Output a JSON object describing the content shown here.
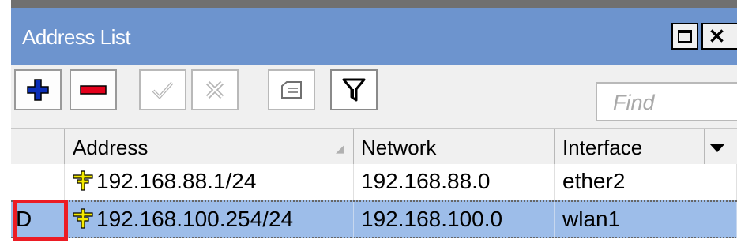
{
  "window": {
    "title": "Address List"
  },
  "toolbar": {
    "add_icon": "plus-icon",
    "remove_icon": "minus-icon",
    "enable_icon": "check-icon",
    "disable_icon": "x-icon",
    "comment_icon": "comment-icon",
    "filter_icon": "funnel-icon",
    "find_placeholder": "Find"
  },
  "table": {
    "columns": [
      "",
      "Address",
      "Network",
      "Interface"
    ],
    "rows": [
      {
        "flag": "",
        "address": "192.168.88.1/24",
        "network": "192.168.88.0",
        "interface": "ether2",
        "selected": false
      },
      {
        "flag": "D",
        "address": "192.168.100.254/24",
        "network": "192.168.100.0",
        "interface": "wlan1",
        "selected": true
      }
    ]
  },
  "colors": {
    "title_bar": "#6d94ce",
    "selected_row": "#9dbde9",
    "add_blue": "#0b2eb8",
    "remove_red": "#e3001b",
    "highlight": "#ec1c24",
    "ip_icon_yellow": "#f5ea00"
  }
}
